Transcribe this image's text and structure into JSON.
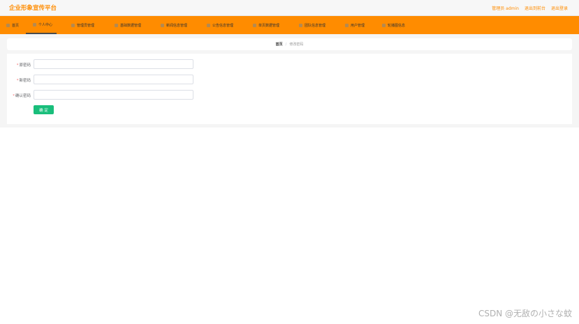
{
  "header": {
    "title": "企业形象宣传平台",
    "links": [
      "管理员 admin",
      "退出到前台",
      "退出登录"
    ]
  },
  "nav": {
    "items": [
      {
        "label": "首页"
      },
      {
        "label": "个人中心"
      },
      {
        "label": "管理员管理"
      },
      {
        "label": "基础数据管理"
      },
      {
        "label": "新闻信息管理"
      },
      {
        "label": "公告信息管理"
      },
      {
        "label": "单页数据管理"
      },
      {
        "label": "团队信息管理"
      },
      {
        "label": "用户管理"
      },
      {
        "label": "轮播图信息"
      }
    ],
    "active_index": 1
  },
  "breadcrumb": {
    "home": "首页",
    "separator": "/",
    "current": "修改密码"
  },
  "form": {
    "fields": [
      {
        "label": "原密码",
        "value": "",
        "required": true
      },
      {
        "label": "新密码",
        "value": "",
        "required": true
      },
      {
        "label": "确认密码",
        "value": "",
        "required": true
      }
    ],
    "submit_label": "确 定"
  },
  "watermark": "CSDN @无敌の小さな蚊",
  "colors": {
    "accent": "#ff8c00",
    "submit": "#19be7b",
    "required": "#f56c6c"
  }
}
